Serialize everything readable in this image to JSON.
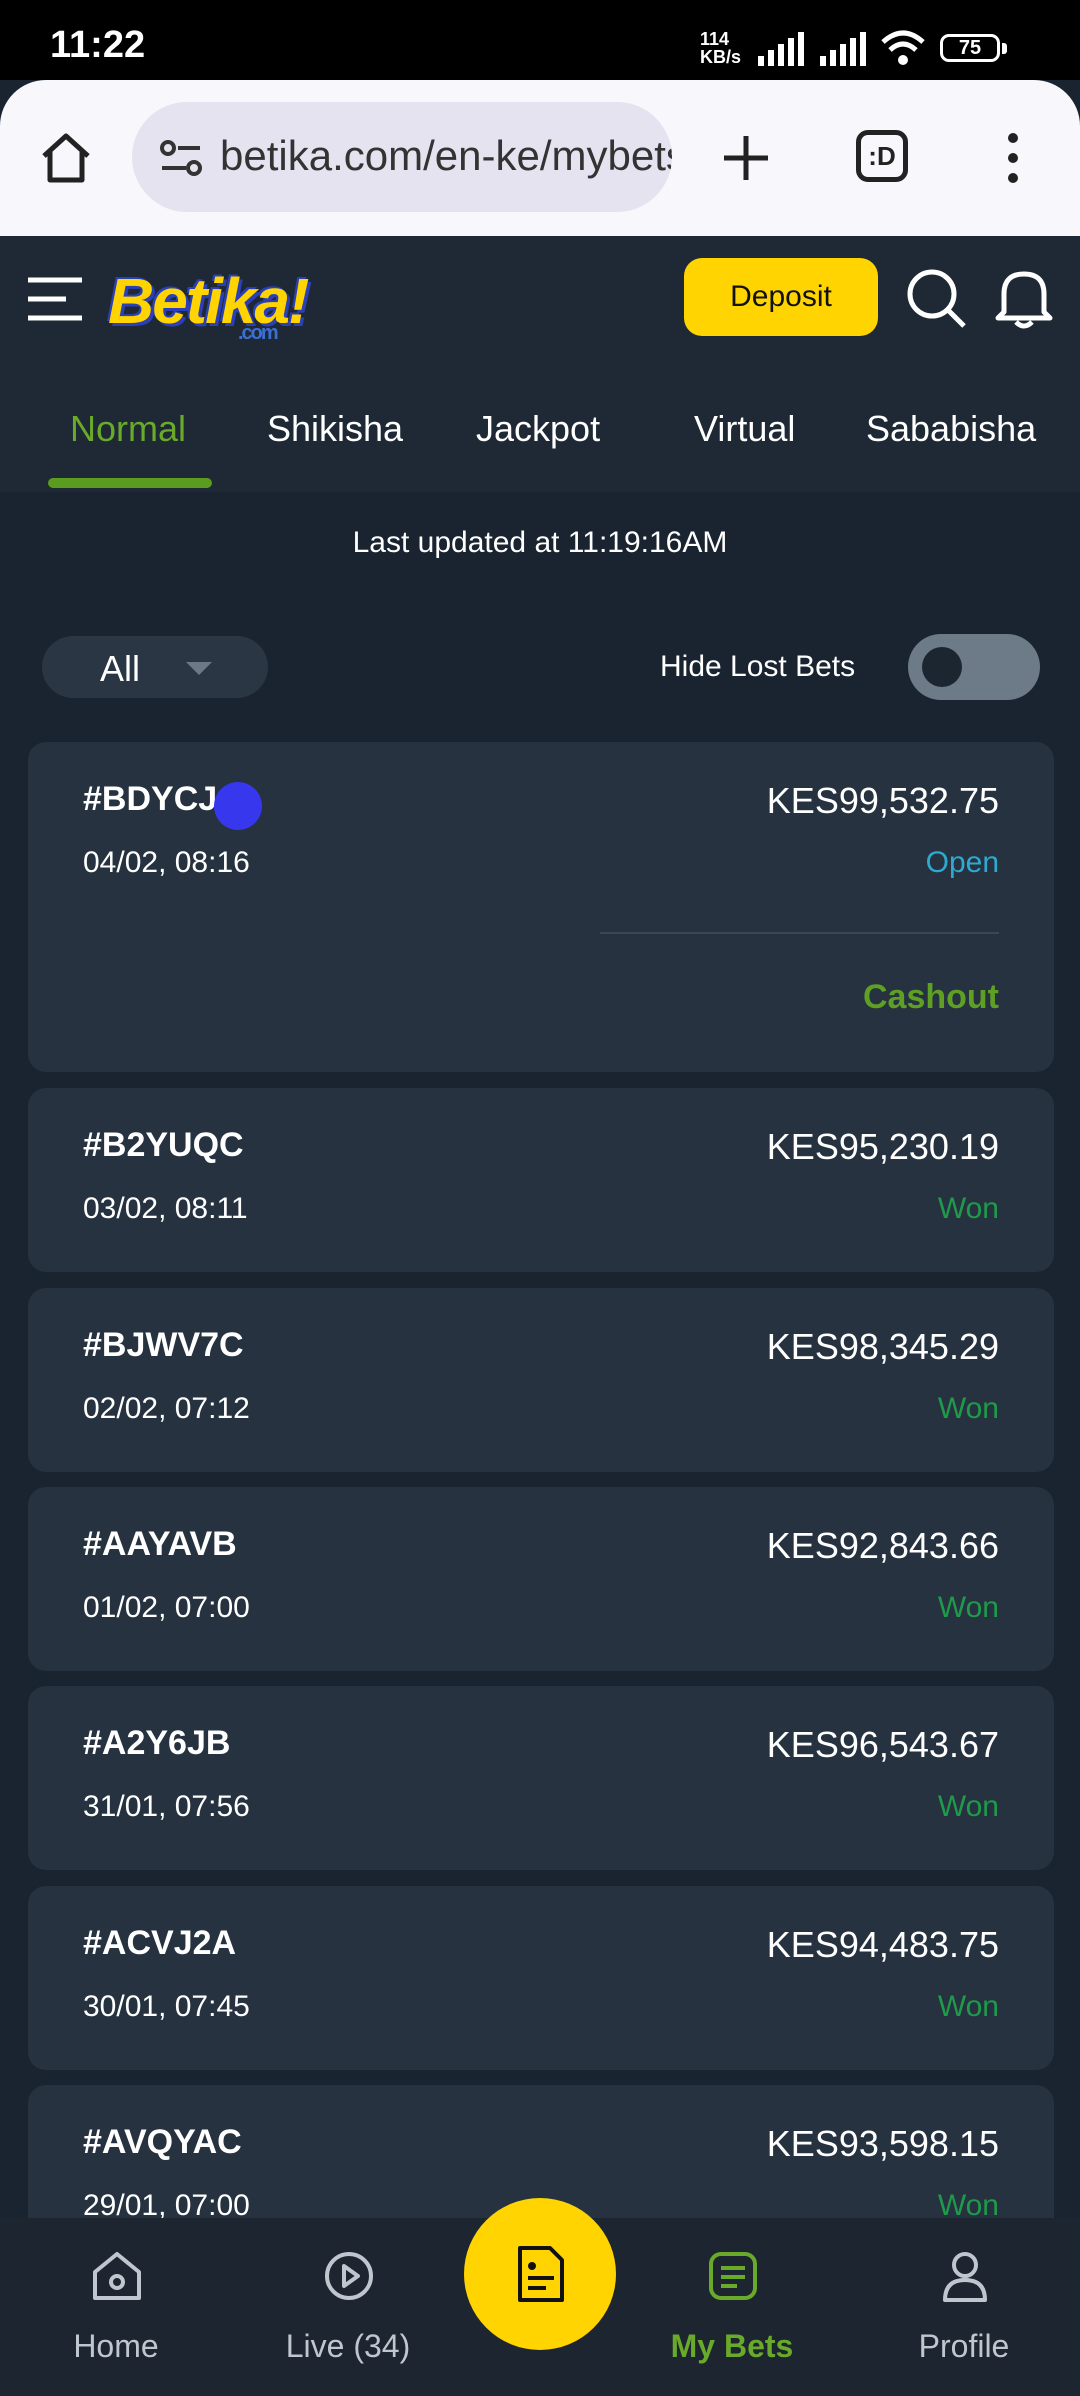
{
  "status_bar": {
    "time": "11:22",
    "net_speed_value": "114",
    "net_speed_unit": "KB/s",
    "battery": "75"
  },
  "browser": {
    "url": "betika.com/en-ke/mybets",
    "tab_switcher_label": ":D"
  },
  "header": {
    "logo_text": "Betika!",
    "logo_sub": ".com",
    "deposit_label": "Deposit"
  },
  "tabs": [
    {
      "label": "Normal",
      "active": true
    },
    {
      "label": "Shikisha",
      "active": false
    },
    {
      "label": "Jackpot",
      "active": false
    },
    {
      "label": "Virtual",
      "active": false
    },
    {
      "label": "Sababisha",
      "active": false
    }
  ],
  "last_updated": "Last updated at 11:19:16AM",
  "filter": {
    "selected": "All",
    "hide_lost_label": "Hide Lost Bets",
    "hide_lost_enabled": false
  },
  "bets": [
    {
      "id": "#BDYCJ",
      "date": "04/02, 08:16",
      "amount": "KES99,532.75",
      "status": "Open",
      "action": "Cashout"
    },
    {
      "id": "#B2YUQC",
      "date": "03/02, 08:11",
      "amount": "KES95,230.19",
      "status": "Won"
    },
    {
      "id": "#BJWV7C",
      "date": "02/02, 07:12",
      "amount": "KES98,345.29",
      "status": "Won"
    },
    {
      "id": "#AAYAVB",
      "date": "01/02, 07:00",
      "amount": "KES92,843.66",
      "status": "Won"
    },
    {
      "id": "#A2Y6JB",
      "date": "31/01, 07:56",
      "amount": "KES96,543.67",
      "status": "Won"
    },
    {
      "id": "#ACVJ2A",
      "date": "30/01, 07:45",
      "amount": "KES94,483.75",
      "status": "Won"
    },
    {
      "id": "#AVQYAC",
      "date": "29/01, 07:00",
      "amount": "KES93,598.15",
      "status": "Won"
    }
  ],
  "bottom_nav": {
    "home": "Home",
    "live": "Live (34)",
    "my_bets": "My Bets",
    "profile": "Profile"
  },
  "colors": {
    "accent_green": "#6aaa2a",
    "won_green": "#1e9a4a",
    "open_blue": "#2fa9cf",
    "brand_yellow": "#ffd400",
    "background": "#1a2430",
    "card": "#26323f"
  }
}
